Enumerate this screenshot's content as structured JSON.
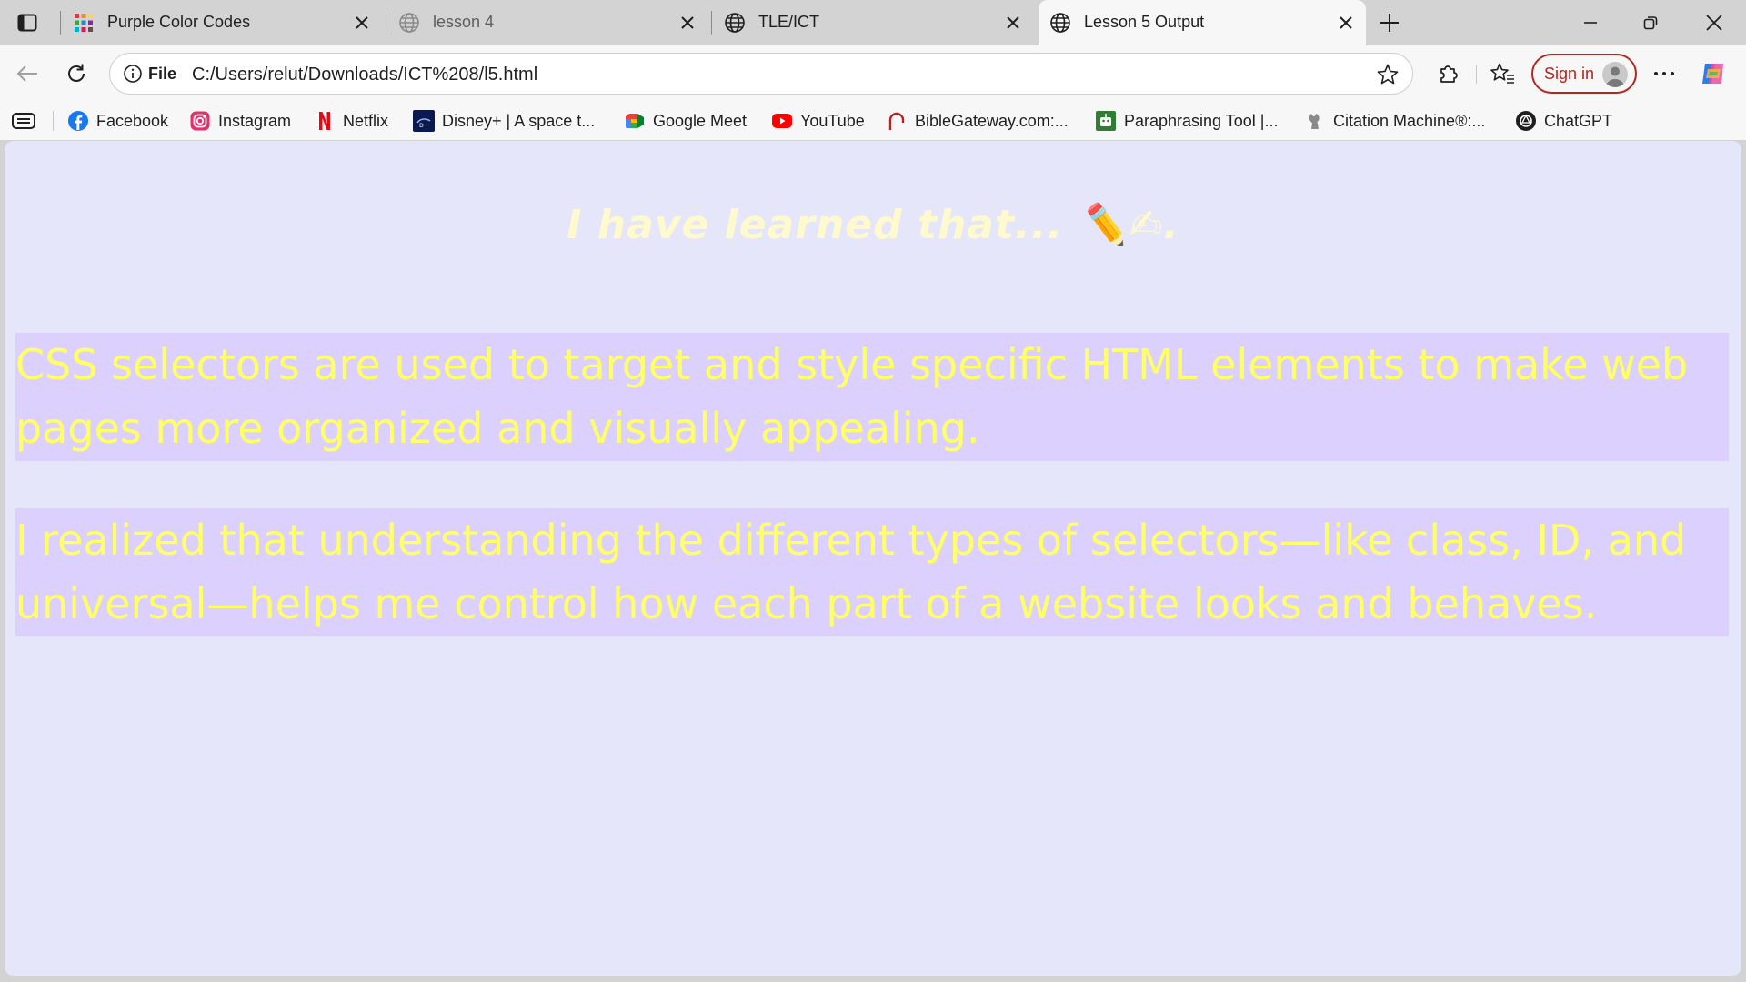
{
  "browser": {
    "tabs": [
      {
        "title": "Purple Color Codes",
        "favicon": "color-grid-icon",
        "active": false
      },
      {
        "title": "lesson 4",
        "favicon": "globe-icon",
        "active": false
      },
      {
        "title": "TLE/ICT",
        "favicon": "globe-icon",
        "active": false
      },
      {
        "title": "Lesson 5 Output",
        "favicon": "globe-icon",
        "active": true
      }
    ],
    "address_bar": {
      "scheme_label": "File",
      "url": "C:/Users/relut/Downloads/ICT%208/l5.html"
    },
    "sign_in_label": "Sign in",
    "bookmarks": [
      {
        "label": "Facebook",
        "icon": "facebook-icon",
        "color": "#1877f2"
      },
      {
        "label": "Instagram",
        "icon": "instagram-icon",
        "color": "#e1306c"
      },
      {
        "label": "Netflix",
        "icon": "netflix-icon",
        "color": "#e50914"
      },
      {
        "label": "Disney+ | A space t...",
        "icon": "disney-plus-icon",
        "color": "#0a1a4e"
      },
      {
        "label": "Google Meet",
        "icon": "google-meet-icon",
        "color": "#00897b"
      },
      {
        "label": "YouTube",
        "icon": "youtube-icon",
        "color": "#ff0000"
      },
      {
        "label": "BibleGateway.com:...",
        "icon": "biblegateway-icon",
        "color": "#b22222"
      },
      {
        "label": "Paraphrasing Tool |...",
        "icon": "paraphrasing-tool-icon",
        "color": "#2e7d32"
      },
      {
        "label": "Citation Machine®:...",
        "icon": "citation-machine-icon",
        "color": "#6d6d6d"
      },
      {
        "label": "ChatGPT",
        "icon": "chatgpt-icon",
        "color": "#1f1f1f"
      }
    ]
  },
  "page": {
    "heading": "I have learned that... ✏️✍.",
    "paragraphs": [
      "CSS selectors are used to target and style specific HTML elements to make web pages more organized and visually appealing.",
      "I realized that understanding the different types of selectors—like class, ID, and universal—helps me control how each part of a website looks and behaves."
    ],
    "colors": {
      "background": "#e6e6fa",
      "paragraph_background": "#dcd0ff",
      "paragraph_text": "#ffff66",
      "heading_text": "#fffacd"
    }
  }
}
